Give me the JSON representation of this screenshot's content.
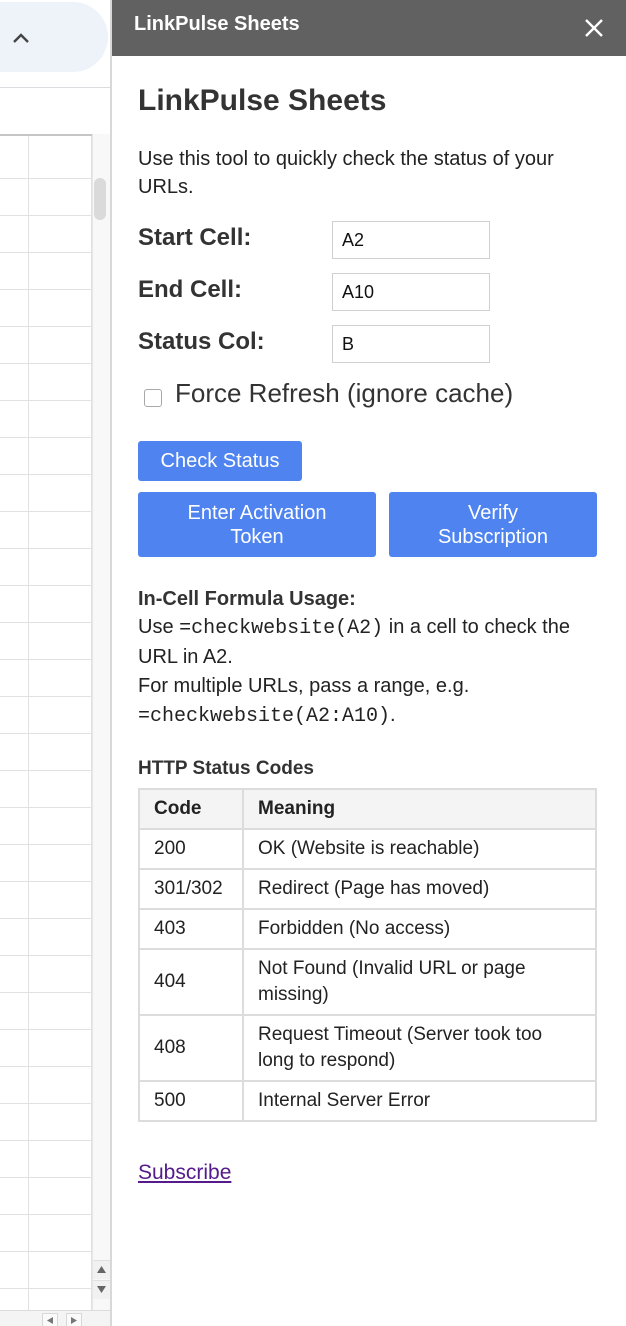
{
  "panel": {
    "titlebar": "LinkPulse Sheets",
    "heading": "LinkPulse Sheets",
    "intro": "Use this tool to quickly check the status of your URLs."
  },
  "form": {
    "start_label": "Start Cell:",
    "start_value": "A2",
    "end_label": "End Cell:",
    "end_value": "A10",
    "status_label": "Status Col:",
    "status_value": "B",
    "force_refresh_label": "Force Refresh (ignore cache)",
    "force_refresh_checked": false
  },
  "buttons": {
    "check_status": "Check Status",
    "enter_token_line1": "Enter Activation",
    "enter_token_line2": "Token",
    "verify_line1": "Verify",
    "verify_line2": "Subscription",
    "color": "#4f84f0"
  },
  "formula": {
    "heading": "In-Cell Formula Usage:",
    "use_prefix": "Use",
    "example_single": "=checkwebsite(A2)",
    "use_suffix": "in a cell to check the URL in A2.",
    "multi_prefix": "For multiple URLs, pass a range, e.g.",
    "example_range": "=checkwebsite(A2:A10)",
    "multi_suffix": "."
  },
  "status_codes": {
    "heading": "HTTP Status Codes",
    "headers": [
      "Code",
      "Meaning"
    ],
    "rows": [
      {
        "code": "200",
        "meaning": "OK (Website is reachable)"
      },
      {
        "code": "301/302",
        "meaning": "Redirect (Page has moved)"
      },
      {
        "code": "403",
        "meaning": "Forbidden (No access)"
      },
      {
        "code": "404",
        "meaning": "Not Found (Invalid URL or page missing)"
      },
      {
        "code": "408",
        "meaning": "Request Timeout (Server took too long to respond)"
      },
      {
        "code": "500",
        "meaning": "Internal Server Error"
      }
    ]
  },
  "links": {
    "subscribe": "Subscribe"
  },
  "icons": {
    "collapse": "chevron-up-icon",
    "close": "close-icon",
    "scroll_up": "triangle-up-icon",
    "scroll_down": "triangle-down-icon",
    "scroll_left": "triangle-left-icon",
    "scroll_right": "triangle-right-icon"
  },
  "colors": {
    "titlebar_bg": "#616161",
    "link": "#551a8b"
  }
}
